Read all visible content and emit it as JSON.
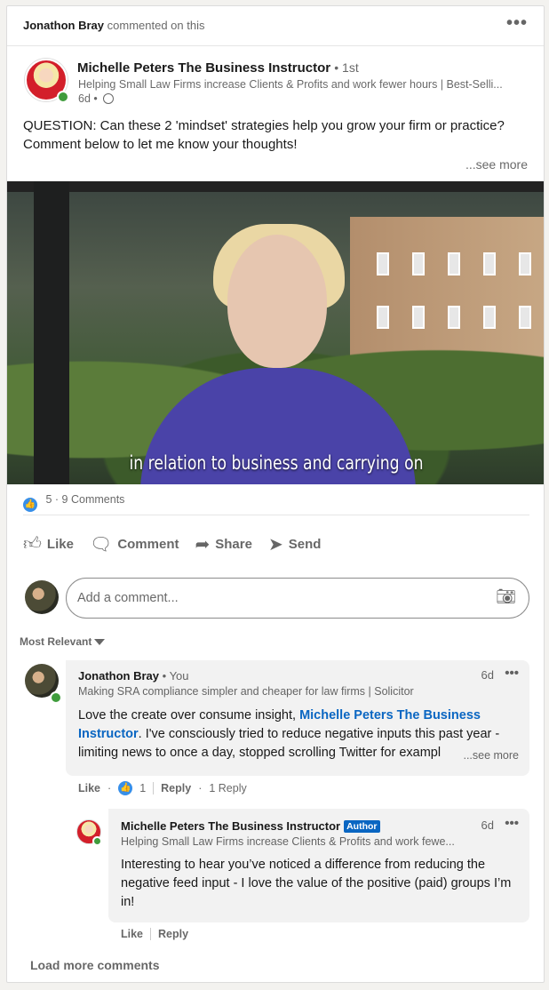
{
  "activity": {
    "actor": "Jonathon Bray",
    "verb": "commented on this"
  },
  "post": {
    "author_name": "Michelle Peters The Business Instructor",
    "degree": "• 1st",
    "headline": "Helping Small Law Firms increase Clients & Profits and work fewer hours | Best-Selli...",
    "age": "6d •",
    "text": "QUESTION: Can these 2 'mindset' strategies help you grow your firm or practice? Comment below to let me know your thoughts!",
    "see_more": "...see more",
    "video_caption": "in relation to business and carrying on"
  },
  "social": {
    "reactions": "5",
    "comments": "· 9 Comments"
  },
  "actions": {
    "like": "Like",
    "comment": "Comment",
    "share": "Share",
    "send": "Send"
  },
  "comment_input": {
    "placeholder": "Add a comment..."
  },
  "sort": {
    "label": "Most Relevant"
  },
  "comments": [
    {
      "name": "Jonathon Bray",
      "you": "• You",
      "headline": "Making SRA compliance simpler and cheaper for law firms | Solicitor",
      "time": "6d",
      "body_pre": "Love the create over consume insight,",
      "mention": "Michelle Peters The Business Instructor",
      "body_post": ". I've consciously tried to reduce negative inputs this past year - limiting news to once a day, stopped scrolling Twitter for exampl",
      "see_more": "...see more",
      "like": "Like",
      "like_count": "1",
      "reply": "Reply",
      "replies": "1 Reply"
    },
    {
      "name": "Michelle Peters The Business Instructor",
      "badge": "Author",
      "headline": "Helping Small Law Firms increase Clients & Profits and work fewe...",
      "time": "6d",
      "body": "Interesting to hear you’ve noticed a difference from reducing the negative feed input - I love the value of the positive (paid) groups I’m in!",
      "like": "Like",
      "reply": "Reply"
    }
  ],
  "load_more": "Load more comments"
}
